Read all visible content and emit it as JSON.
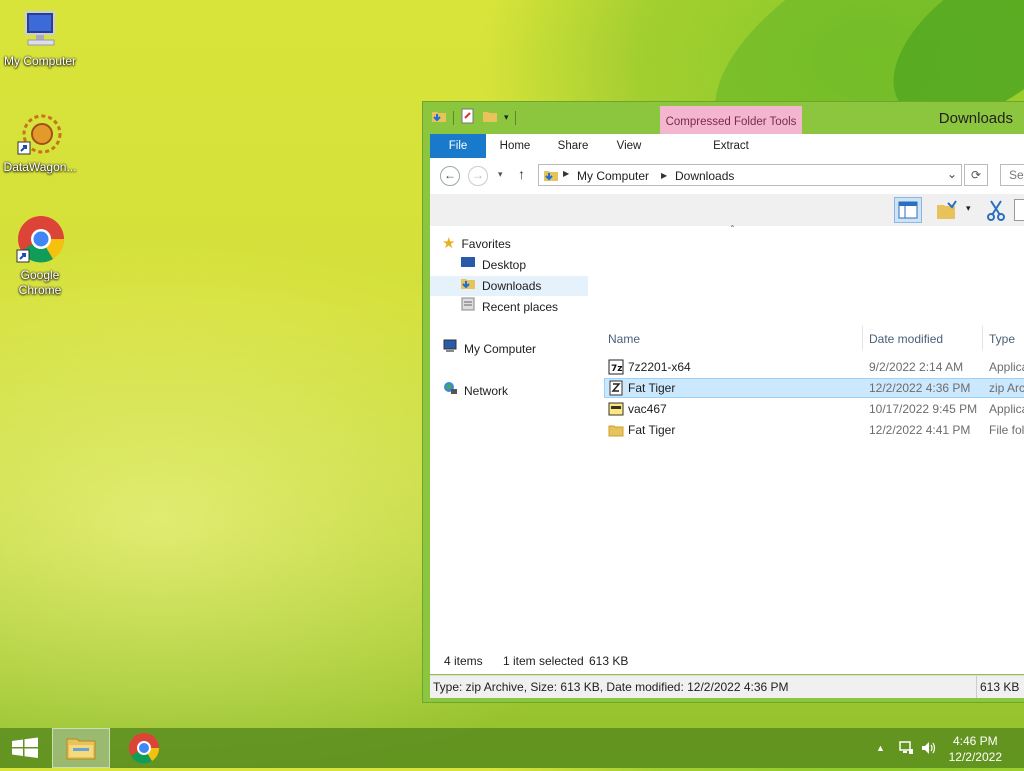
{
  "desktop": {
    "icons": [
      {
        "label": "My Computer",
        "icon": "computer-icon"
      },
      {
        "label": "DataWagon...",
        "icon": "datawagon-icon"
      },
      {
        "label": "Google Chrome",
        "icon": "chrome-icon"
      }
    ]
  },
  "window": {
    "title": "Downloads",
    "context_tab_group": "Compressed Folder Tools",
    "ribbon_tabs": [
      "File",
      "Home",
      "Share",
      "View",
      "Extract"
    ],
    "address": {
      "crumbs": [
        "My Computer",
        "Downloads"
      ]
    },
    "search_placeholder": "Sea",
    "nav": {
      "favorites_label": "Favorites",
      "favorites_items": [
        "Desktop",
        "Downloads",
        "Recent places"
      ],
      "computer_label": "My Computer",
      "network_label": "Network",
      "selected": "Downloads"
    },
    "columns": [
      "Name",
      "Date modified",
      "Type"
    ],
    "files": [
      {
        "name": "7z2201-x64",
        "date": "9/2/2022 2:14 AM",
        "type": "Applica",
        "icon": "7zip-icon",
        "selected": false
      },
      {
        "name": "Fat Tiger",
        "date": "12/2/2022 4:36 PM",
        "type": "zip Arc",
        "icon": "zip-icon",
        "selected": true
      },
      {
        "name": "vac467",
        "date": "10/17/2022 9:45 PM",
        "type": "Applica",
        "icon": "app-icon",
        "selected": false
      },
      {
        "name": "Fat Tiger",
        "date": "12/2/2022 4:41 PM",
        "type": "File fol",
        "icon": "folder-icon",
        "selected": false
      }
    ],
    "status": {
      "items_count": "4 items",
      "selection": "1 item selected",
      "selection_size": "613 KB"
    },
    "details_bar": {
      "text": "Type: zip Archive, Size: 613 KB, Date modified: 12/2/2022 4:36 PM",
      "size": "613 KB"
    }
  },
  "taskbar": {
    "time": "4:46 PM",
    "date": "12/2/2022"
  },
  "colors": {
    "window_frame": "#8cc63f",
    "file_tab": "#1979ca",
    "context_tab": "#f4b6cf",
    "selection": "#cce8ff"
  }
}
